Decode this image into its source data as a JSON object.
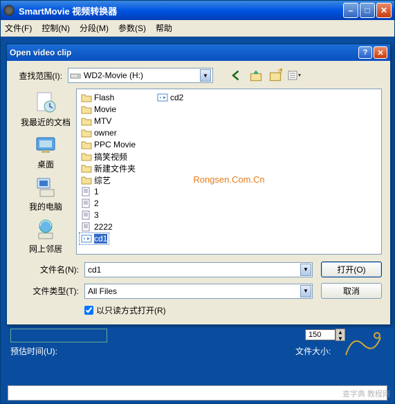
{
  "app": {
    "title": "SmartMovie 视频转换器",
    "menus": [
      "文件(F)",
      "控制(N)",
      "分段(M)",
      "参数(S)",
      "帮助"
    ]
  },
  "dialog": {
    "title": "Open video clip",
    "look_in_label": "查找范围(I):",
    "look_in_value": "WD2-Movie (H:)",
    "places": [
      {
        "label": "我最近的文档"
      },
      {
        "label": "桌面"
      },
      {
        "label": "我的电脑"
      },
      {
        "label": "网上邻居"
      }
    ],
    "files_col1": [
      {
        "name": "Flash",
        "type": "folder"
      },
      {
        "name": "Movie",
        "type": "folder"
      },
      {
        "name": "MTV",
        "type": "folder"
      },
      {
        "name": "owner",
        "type": "folder"
      },
      {
        "name": "PPC Movie",
        "type": "folder"
      },
      {
        "name": "搞笑视频",
        "type": "folder"
      },
      {
        "name": "新建文件夹",
        "type": "folder"
      },
      {
        "name": "综艺",
        "type": "folder"
      },
      {
        "name": "1",
        "type": "file"
      },
      {
        "name": "2",
        "type": "file"
      },
      {
        "name": "3",
        "type": "file"
      },
      {
        "name": "2222",
        "type": "file"
      },
      {
        "name": "cd1",
        "type": "video",
        "selected": true
      }
    ],
    "files_col2": [
      {
        "name": "cd2",
        "type": "video"
      }
    ],
    "watermark": "Rongsen.Com.Cn",
    "filename_label": "文件名(N):",
    "filename_value": "cd1",
    "filetype_label": "文件类型(T):",
    "filetype_value": "All Files",
    "readonly_label": "以只读方式打开(R)",
    "readonly_checked": true,
    "open_label": "打开(O)",
    "cancel_label": "取消"
  },
  "bg": {
    "estimate_label": "预估时间(U):",
    "value_150": "150",
    "filesize_label": "文件大小:",
    "corner_watermark": "查字典 教程网"
  }
}
